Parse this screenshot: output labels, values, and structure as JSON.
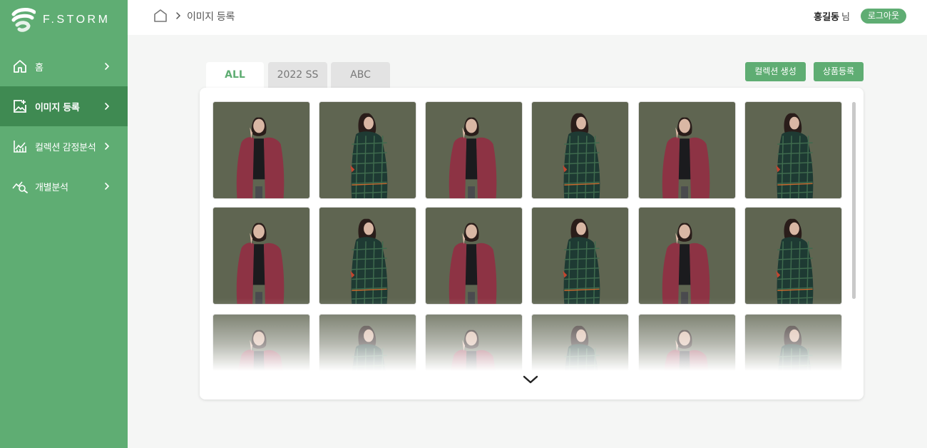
{
  "brand": {
    "name": "F.STORM"
  },
  "sidebar": {
    "items": [
      {
        "label": "홈",
        "icon": "home-icon",
        "active": false
      },
      {
        "label": "이미지 등록",
        "icon": "image-add-icon",
        "active": true
      },
      {
        "label": "컬렉션 감정분석",
        "icon": "chart-line-icon",
        "active": false
      },
      {
        "label": "개별분석",
        "icon": "analysis-search-icon",
        "active": false
      }
    ]
  },
  "header": {
    "breadcrumb": "이미지 등록",
    "user_name": "홍길동",
    "user_suffix": "님",
    "logout_label": "로그아웃"
  },
  "tabs": [
    {
      "label": "ALL",
      "active": true
    },
    {
      "label": "2022 SS",
      "active": false
    },
    {
      "label": "ABC",
      "active": false
    }
  ],
  "actions": {
    "create_collection": "컬렉션 생성",
    "register_product": "상품등록"
  },
  "gallery": {
    "columns": 6,
    "rows_visible": 3,
    "pattern": [
      "red-coat",
      "plaid-coat"
    ]
  },
  "colors": {
    "brand_green": "#5fad73",
    "active_nav": "#3f8a52",
    "photo_bg": "#5f6551",
    "red_coat": "#8d3344",
    "plaid_coat": "#1e3a33"
  }
}
